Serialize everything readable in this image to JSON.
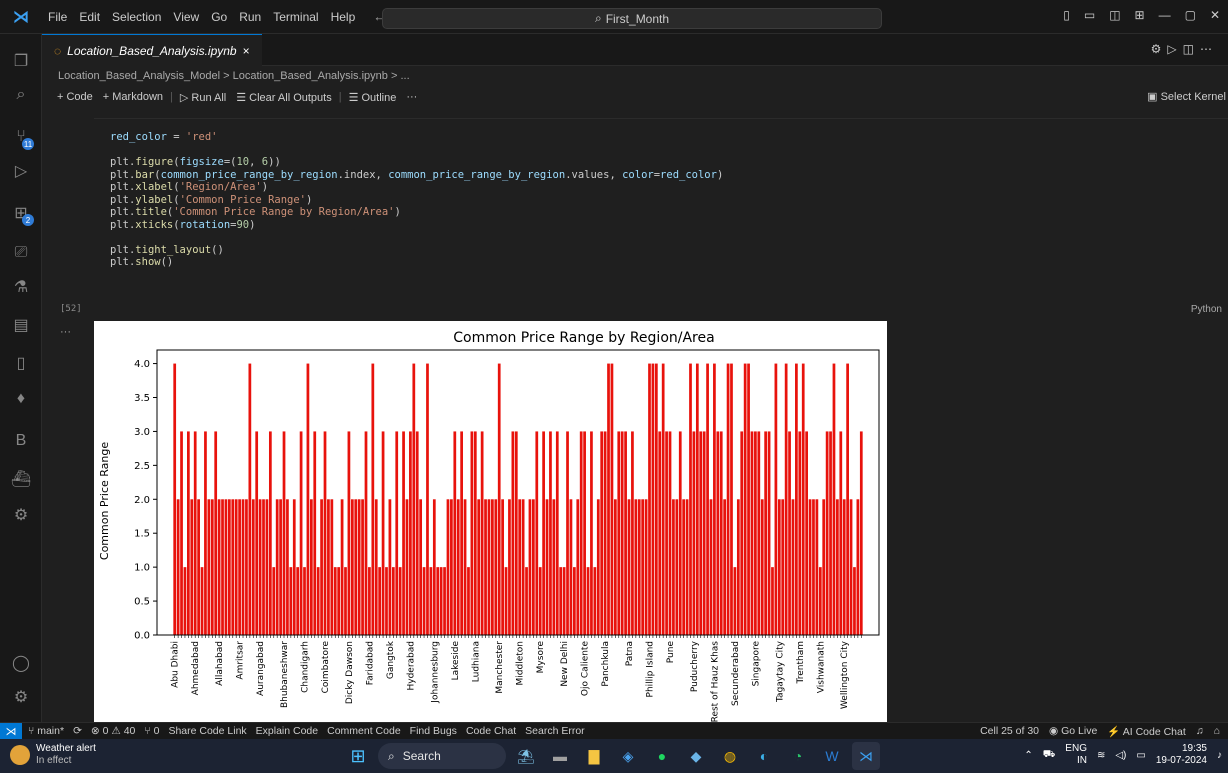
{
  "titlebar": {
    "menu": [
      "File",
      "Edit",
      "Selection",
      "View",
      "Go",
      "Run",
      "Terminal",
      "Help"
    ],
    "search": "First_Month"
  },
  "tab": {
    "label": "Location_Based_Analysis.ipynb",
    "close": "×"
  },
  "breadcrumb": "Location_Based_Analysis_Model > Location_Based_Analysis.ipynb > ...",
  "toolbar": {
    "code": "+ Code",
    "markdown": "+ Markdown",
    "run_all": "Run All",
    "clear_outputs": "Clear All Outputs",
    "outline": "Outline",
    "more": "···",
    "select_kernel": "Select Kernel"
  },
  "cell": {
    "exec_count": "[52]",
    "language": "Python",
    "code": [
      "red_color = 'red'",
      "",
      "plt.figure(figsize=(10, 6))",
      "plt.bar(common_price_range_by_region.index, common_price_range_by_region.values, color=red_color)",
      "plt.xlabel('Region/Area')",
      "plt.ylabel('Common Price Range')",
      "plt.title('Common Price Range by Region/Area')",
      "plt.xticks(rotation=90)",
      "",
      "plt.tight_layout()",
      "plt.show()"
    ],
    "output_dots": "···"
  },
  "chart_data": {
    "type": "bar",
    "title": "Common Price Range by Region/Area",
    "xlabel": "",
    "ylabel": "Common Price Range",
    "ylim": [
      0,
      4.2
    ],
    "yticks": [
      "0.0",
      "0.5",
      "1.0",
      "1.5",
      "2.0",
      "2.5",
      "3.0",
      "3.5",
      "4.0"
    ],
    "grid": false,
    "color": "#e8120c",
    "values": [
      4,
      2,
      3,
      1,
      3,
      2,
      3,
      2,
      1,
      3,
      2,
      2,
      3,
      2,
      2,
      2,
      2,
      2,
      2,
      2,
      2,
      2,
      4,
      2,
      3,
      2,
      2,
      2,
      3,
      1,
      2,
      2,
      3,
      2,
      1,
      2,
      1,
      3,
      1,
      4,
      2,
      3,
      1,
      2,
      3,
      2,
      2,
      1,
      1,
      2,
      1,
      3,
      2,
      2,
      2,
      2,
      3,
      1,
      4,
      2,
      1,
      3,
      1,
      2,
      1,
      3,
      1,
      3,
      2,
      3,
      4,
      3,
      2,
      1,
      4,
      1,
      2,
      1,
      1,
      1,
      2,
      2,
      3,
      2,
      3,
      2,
      1,
      3,
      3,
      2,
      3,
      2,
      2,
      2,
      2,
      4,
      2,
      1,
      2,
      3,
      3,
      2,
      2,
      1,
      2,
      2,
      3,
      1,
      3,
      2,
      3,
      2,
      3,
      1,
      1,
      3,
      2,
      1,
      2,
      3,
      3,
      1,
      3,
      1,
      2,
      3,
      3,
      4,
      4,
      2,
      3,
      3,
      3,
      2,
      3,
      2,
      2,
      2,
      2,
      4,
      4,
      4,
      3,
      4,
      3,
      3,
      2,
      2,
      3,
      2,
      2,
      4,
      3,
      4,
      3,
      3,
      4,
      2,
      4,
      3,
      3,
      2,
      4,
      4,
      1,
      2,
      3,
      4,
      4,
      3,
      3,
      3,
      2,
      3,
      3,
      1,
      4,
      2,
      2,
      4,
      3,
      2,
      4,
      3,
      4,
      3,
      2,
      2,
      2,
      1,
      2,
      3,
      3,
      4,
      2,
      3,
      2,
      4,
      2,
      1,
      2,
      3
    ],
    "visible_tick_labels": [
      "Abu Dhabi",
      "Ahmedabad",
      "Allahabad",
      "Amritsar",
      "Aurangabad",
      "Bhubaneshwar",
      "Chandigarh",
      "Coimbatore",
      "Dicky Dawson",
      "Faridabad",
      "Gangtok",
      "Hyderabad",
      "Johannesburg",
      "Lakeside",
      "Ludhiana",
      "Manchester",
      "Middleton",
      "Mysore",
      "New Delhi",
      "Ojo Caliente",
      "Panchkula",
      "Patna",
      "Phillip Island",
      "Pune",
      "Puducherry",
      "Rest of Hauz Khas",
      "Secunderabad",
      "Singapore",
      "Tagaytay City",
      "Trentham",
      "Vishwanath",
      "Wellington City"
    ]
  },
  "statusbar": {
    "branch": "main*",
    "sync": "⟳",
    "problems": "⊗ 0 ⚠ 40",
    "ports": "⑂ 0",
    "items": [
      "Share Code Link",
      "Explain Code",
      "Comment Code",
      "Find Bugs",
      "Code Chat",
      "Search Error"
    ],
    "cell_pos": "Cell 25 of 30",
    "go_live": "Go Live",
    "ai_chat": "AI Code Chat"
  },
  "taskbar": {
    "weather_title": "Weather alert",
    "weather_sub": "In effect",
    "search": "Search",
    "lang": "ENG",
    "lang_sub": "IN",
    "time": "19:35",
    "date": "19-07-2024"
  }
}
